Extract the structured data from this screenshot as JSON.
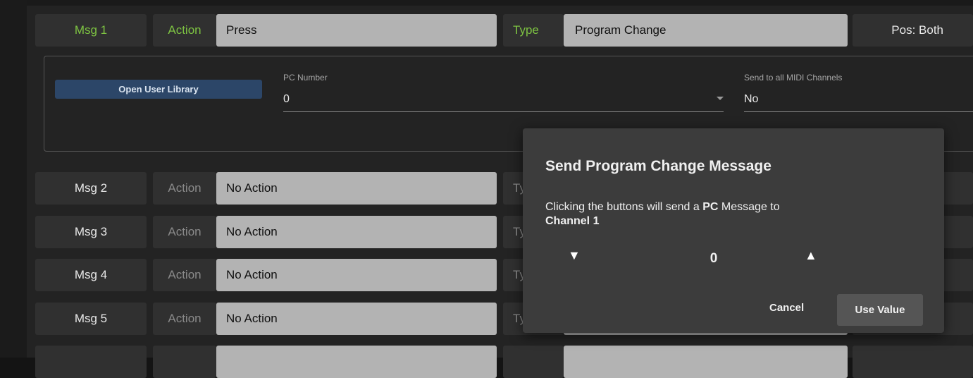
{
  "messages": [
    {
      "msg": "Msg 1",
      "action_label": "Action",
      "action": "Press",
      "type_label": "Type",
      "type": "Program Change",
      "pos": "Pos: Both"
    },
    {
      "msg": "Msg 2",
      "action_label": "Action",
      "action": "No Action",
      "type_label": "Ty"
    },
    {
      "msg": "Msg 3",
      "action_label": "Action",
      "action": "No Action",
      "type_label": "Ty"
    },
    {
      "msg": "Msg 4",
      "action_label": "Action",
      "action": "No Action",
      "type_label": "Ty"
    },
    {
      "msg": "Msg 5",
      "action_label": "Action",
      "action": "No Action",
      "type_label": "Ty"
    }
  ],
  "panel": {
    "library_button": "Open User Library",
    "pc_number_label": "PC Number",
    "pc_number_value": "0",
    "send_all_label": "Send to all MIDI Channels",
    "send_all_value": "No"
  },
  "modal": {
    "title": "Send Program Change Message",
    "text_prefix": "Clicking the buttons will send a ",
    "text_bold1": "PC",
    "text_mid": " Message to",
    "text_bold2": "Channel 1",
    "down_arrow": "▼",
    "value": "0",
    "up_arrow": "▲",
    "cancel": "Cancel",
    "use_value": "Use Value"
  },
  "colors": {
    "accent_green": "#7dc242",
    "library_blue": "#2c4668"
  },
  "icons": [
    "chevron-down-icon",
    "decrement-arrow-icon",
    "increment-arrow-icon"
  ]
}
